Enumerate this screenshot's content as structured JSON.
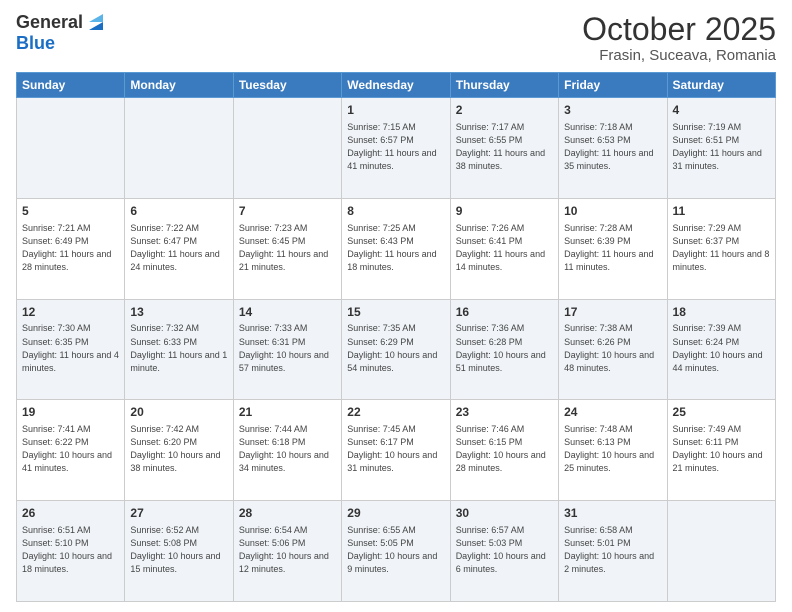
{
  "header": {
    "logo_general": "General",
    "logo_blue": "Blue",
    "month": "October 2025",
    "location": "Frasin, Suceava, Romania"
  },
  "days_of_week": [
    "Sunday",
    "Monday",
    "Tuesday",
    "Wednesday",
    "Thursday",
    "Friday",
    "Saturday"
  ],
  "weeks": [
    [
      {
        "day": "",
        "info": ""
      },
      {
        "day": "",
        "info": ""
      },
      {
        "day": "",
        "info": ""
      },
      {
        "day": "1",
        "info": "Sunrise: 7:15 AM\nSunset: 6:57 PM\nDaylight: 11 hours and 41 minutes."
      },
      {
        "day": "2",
        "info": "Sunrise: 7:17 AM\nSunset: 6:55 PM\nDaylight: 11 hours and 38 minutes."
      },
      {
        "day": "3",
        "info": "Sunrise: 7:18 AM\nSunset: 6:53 PM\nDaylight: 11 hours and 35 minutes."
      },
      {
        "day": "4",
        "info": "Sunrise: 7:19 AM\nSunset: 6:51 PM\nDaylight: 11 hours and 31 minutes."
      }
    ],
    [
      {
        "day": "5",
        "info": "Sunrise: 7:21 AM\nSunset: 6:49 PM\nDaylight: 11 hours and 28 minutes."
      },
      {
        "day": "6",
        "info": "Sunrise: 7:22 AM\nSunset: 6:47 PM\nDaylight: 11 hours and 24 minutes."
      },
      {
        "day": "7",
        "info": "Sunrise: 7:23 AM\nSunset: 6:45 PM\nDaylight: 11 hours and 21 minutes."
      },
      {
        "day": "8",
        "info": "Sunrise: 7:25 AM\nSunset: 6:43 PM\nDaylight: 11 hours and 18 minutes."
      },
      {
        "day": "9",
        "info": "Sunrise: 7:26 AM\nSunset: 6:41 PM\nDaylight: 11 hours and 14 minutes."
      },
      {
        "day": "10",
        "info": "Sunrise: 7:28 AM\nSunset: 6:39 PM\nDaylight: 11 hours and 11 minutes."
      },
      {
        "day": "11",
        "info": "Sunrise: 7:29 AM\nSunset: 6:37 PM\nDaylight: 11 hours and 8 minutes."
      }
    ],
    [
      {
        "day": "12",
        "info": "Sunrise: 7:30 AM\nSunset: 6:35 PM\nDaylight: 11 hours and 4 minutes."
      },
      {
        "day": "13",
        "info": "Sunrise: 7:32 AM\nSunset: 6:33 PM\nDaylight: 11 hours and 1 minute."
      },
      {
        "day": "14",
        "info": "Sunrise: 7:33 AM\nSunset: 6:31 PM\nDaylight: 10 hours and 57 minutes."
      },
      {
        "day": "15",
        "info": "Sunrise: 7:35 AM\nSunset: 6:29 PM\nDaylight: 10 hours and 54 minutes."
      },
      {
        "day": "16",
        "info": "Sunrise: 7:36 AM\nSunset: 6:28 PM\nDaylight: 10 hours and 51 minutes."
      },
      {
        "day": "17",
        "info": "Sunrise: 7:38 AM\nSunset: 6:26 PM\nDaylight: 10 hours and 48 minutes."
      },
      {
        "day": "18",
        "info": "Sunrise: 7:39 AM\nSunset: 6:24 PM\nDaylight: 10 hours and 44 minutes."
      }
    ],
    [
      {
        "day": "19",
        "info": "Sunrise: 7:41 AM\nSunset: 6:22 PM\nDaylight: 10 hours and 41 minutes."
      },
      {
        "day": "20",
        "info": "Sunrise: 7:42 AM\nSunset: 6:20 PM\nDaylight: 10 hours and 38 minutes."
      },
      {
        "day": "21",
        "info": "Sunrise: 7:44 AM\nSunset: 6:18 PM\nDaylight: 10 hours and 34 minutes."
      },
      {
        "day": "22",
        "info": "Sunrise: 7:45 AM\nSunset: 6:17 PM\nDaylight: 10 hours and 31 minutes."
      },
      {
        "day": "23",
        "info": "Sunrise: 7:46 AM\nSunset: 6:15 PM\nDaylight: 10 hours and 28 minutes."
      },
      {
        "day": "24",
        "info": "Sunrise: 7:48 AM\nSunset: 6:13 PM\nDaylight: 10 hours and 25 minutes."
      },
      {
        "day": "25",
        "info": "Sunrise: 7:49 AM\nSunset: 6:11 PM\nDaylight: 10 hours and 21 minutes."
      }
    ],
    [
      {
        "day": "26",
        "info": "Sunrise: 6:51 AM\nSunset: 5:10 PM\nDaylight: 10 hours and 18 minutes."
      },
      {
        "day": "27",
        "info": "Sunrise: 6:52 AM\nSunset: 5:08 PM\nDaylight: 10 hours and 15 minutes."
      },
      {
        "day": "28",
        "info": "Sunrise: 6:54 AM\nSunset: 5:06 PM\nDaylight: 10 hours and 12 minutes."
      },
      {
        "day": "29",
        "info": "Sunrise: 6:55 AM\nSunset: 5:05 PM\nDaylight: 10 hours and 9 minutes."
      },
      {
        "day": "30",
        "info": "Sunrise: 6:57 AM\nSunset: 5:03 PM\nDaylight: 10 hours and 6 minutes."
      },
      {
        "day": "31",
        "info": "Sunrise: 6:58 AM\nSunset: 5:01 PM\nDaylight: 10 hours and 2 minutes."
      },
      {
        "day": "",
        "info": ""
      }
    ]
  ]
}
